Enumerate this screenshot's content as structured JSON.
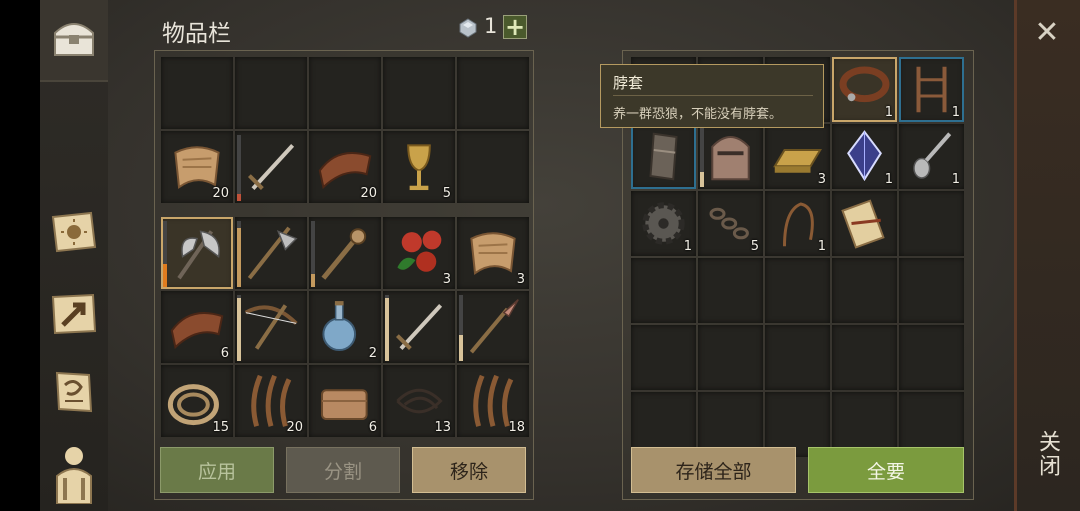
{
  "inventory": {
    "title": "物品栏",
    "currency_count": "1",
    "rows": [
      [
        {
          "icon": "empty"
        },
        {
          "icon": "empty"
        },
        {
          "icon": "empty"
        },
        {
          "icon": "empty"
        },
        {
          "icon": "empty"
        }
      ],
      [
        {
          "icon": "fabric-icon",
          "count": "20"
        },
        {
          "icon": "sword-icon",
          "durability": 0.1,
          "dcolor": "#c0523a"
        },
        {
          "icon": "leather-icon",
          "count": "20"
        },
        {
          "icon": "goblet-icon",
          "count": "5"
        },
        {
          "icon": "empty"
        }
      ],
      [
        {
          "icon": "axe-icon",
          "durability": 0.35,
          "dcolor": "#e07c1e",
          "selected": true
        },
        {
          "icon": "halberd-icon",
          "durability": 0.9,
          "dcolor": "#c49a5e"
        },
        {
          "icon": "mace-icon",
          "durability": 0.2,
          "dcolor": "#c49a5e"
        },
        {
          "icon": "berries-icon",
          "count": "3"
        },
        {
          "icon": "fabric-icon",
          "count": "3"
        }
      ],
      [
        {
          "icon": "leather-icon",
          "count": "6"
        },
        {
          "icon": "crossbow-icon",
          "durability": 0.95,
          "dcolor": "#d8c39a"
        },
        {
          "icon": "potion-icon",
          "count": "2"
        },
        {
          "icon": "sword-icon",
          "durability": 0.95,
          "dcolor": "#d8c39a"
        },
        {
          "icon": "spear-icon",
          "durability": 0.4,
          "dcolor": "#d8c39a"
        }
      ],
      [
        {
          "icon": "rope-icon",
          "count": "15"
        },
        {
          "icon": "fiber-icon",
          "count": "20"
        },
        {
          "icon": "cloth-icon",
          "count": "6"
        },
        {
          "icon": "cord-icon",
          "count": "13"
        },
        {
          "icon": "fiber-icon",
          "count": "18"
        }
      ]
    ],
    "buttons": {
      "apply": "应用",
      "split": "分割",
      "remove": "移除"
    }
  },
  "storage": {
    "rows": [
      [
        {
          "icon": "hidden"
        },
        {
          "icon": "hidden"
        },
        {
          "icon": "hidden"
        },
        {
          "icon": "collar-icon",
          "count": "1",
          "selected": true
        },
        {
          "icon": "ladder-icon",
          "count": "1",
          "blue": true
        }
      ],
      [
        {
          "icon": "gauntlet-icon",
          "blue": true
        },
        {
          "icon": "helmet-icon",
          "durability": 0.25,
          "dcolor": "#d8c39a"
        },
        {
          "icon": "ingot-icon",
          "count": "3"
        },
        {
          "icon": "crystal-icon",
          "count": "1"
        },
        {
          "icon": "spoon-icon",
          "count": "1"
        }
      ],
      [
        {
          "icon": "gear-icon",
          "count": "1"
        },
        {
          "icon": "chain-icon",
          "count": "5"
        },
        {
          "icon": "whip-icon",
          "count": "1"
        },
        {
          "icon": "scroll-icon"
        },
        {
          "icon": "empty"
        }
      ],
      [
        {
          "icon": "empty"
        },
        {
          "icon": "empty"
        },
        {
          "icon": "empty"
        },
        {
          "icon": "empty"
        },
        {
          "icon": "empty"
        }
      ],
      [
        {
          "icon": "empty"
        },
        {
          "icon": "empty"
        },
        {
          "icon": "empty"
        },
        {
          "icon": "empty"
        },
        {
          "icon": "empty"
        }
      ],
      [
        {
          "icon": "empty"
        },
        {
          "icon": "empty"
        },
        {
          "icon": "empty"
        },
        {
          "icon": "empty"
        },
        {
          "icon": "empty"
        }
      ]
    ],
    "buttons": {
      "store_all": "存储全部",
      "take_all": "全要"
    }
  },
  "tooltip": {
    "title": "脖套",
    "description": "养一群恐狼，不能没有脖套。"
  },
  "close_label": "关闭",
  "side_tabs": [
    "chest-icon",
    "sun-map-icon",
    "arrow-map-icon",
    "scroll-map-icon",
    "character-icon"
  ]
}
